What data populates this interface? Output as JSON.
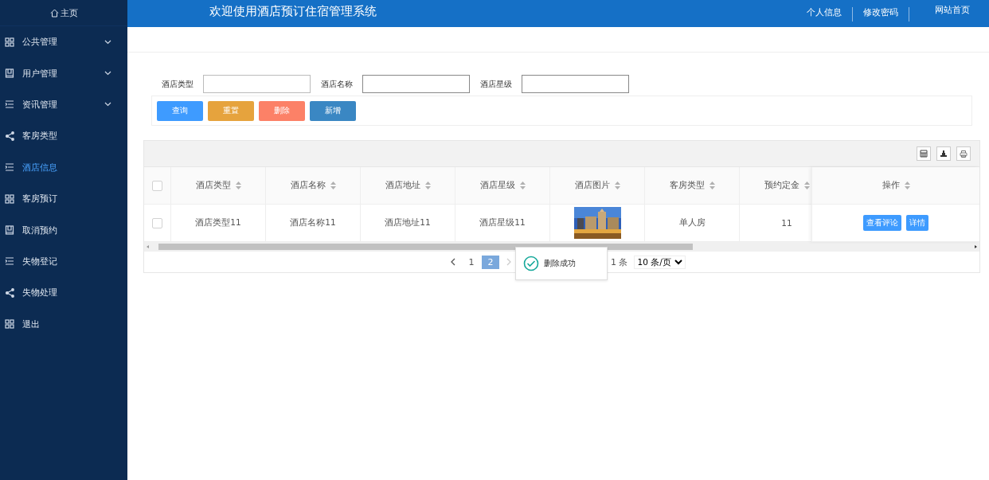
{
  "sidebar": {
    "home": "主页",
    "items": [
      {
        "label": "公共管理",
        "kind": "grid",
        "expandable": true,
        "selected": false
      },
      {
        "label": "用户管理",
        "kind": "book",
        "expandable": true,
        "selected": false
      },
      {
        "label": "资讯管理",
        "kind": "list",
        "expandable": true,
        "selected": false
      },
      {
        "label": "客房类型",
        "kind": "share",
        "expandable": false,
        "selected": false
      },
      {
        "label": "酒店信息",
        "kind": "list",
        "expandable": false,
        "selected": true
      },
      {
        "label": "客房预订",
        "kind": "grid",
        "expandable": false,
        "selected": false
      },
      {
        "label": "取消预约",
        "kind": "book",
        "expandable": false,
        "selected": false
      },
      {
        "label": "失物登记",
        "kind": "list",
        "expandable": false,
        "selected": false
      },
      {
        "label": "失物处理",
        "kind": "share",
        "expandable": false,
        "selected": false
      },
      {
        "label": "退出",
        "kind": "grid",
        "expandable": false,
        "selected": false
      }
    ]
  },
  "header": {
    "title": "欢迎使用酒店预订住宿管理系统",
    "links": [
      "个人信息",
      "修改密码"
    ],
    "site_link": "网站首页"
  },
  "search": {
    "fields": [
      {
        "label": "酒店类型"
      },
      {
        "label": "酒店名称"
      },
      {
        "label": "酒店星级"
      }
    ],
    "buttons": [
      {
        "label": "查询",
        "color": "#3e9bff"
      },
      {
        "label": "重置",
        "color": "#e6a33d"
      },
      {
        "label": "删除",
        "color": "#fc8167"
      },
      {
        "label": "新增",
        "color": "#3a87c3"
      }
    ]
  },
  "table": {
    "select_all": {
      "checked": false
    },
    "columns": [
      "酒店类型",
      "酒店名称",
      "酒店地址",
      "酒店星级",
      "酒店图片",
      "客房类型",
      "预约定金"
    ],
    "action_column": "操作",
    "rows": [
      {
        "checked": false,
        "cells": [
          {
            "kind": "text",
            "text": "酒店类型11"
          },
          {
            "kind": "text",
            "text": "酒店名称11"
          },
          {
            "kind": "text",
            "text": "酒店地址11"
          },
          {
            "kind": "text",
            "text": "酒店星级11"
          },
          {
            "kind": "picture"
          },
          {
            "kind": "text",
            "text": "单人房"
          },
          {
            "kind": "text",
            "text": "11"
          }
        ],
        "actions": [
          "查看评论",
          "详情"
        ]
      }
    ]
  },
  "pagination": {
    "pages": [
      {
        "label": "1",
        "selected": false
      },
      {
        "label": "2",
        "selected": true
      }
    ],
    "total": "1 条",
    "page_size": "10 条/页"
  },
  "toast": {
    "text": "删除成功"
  }
}
